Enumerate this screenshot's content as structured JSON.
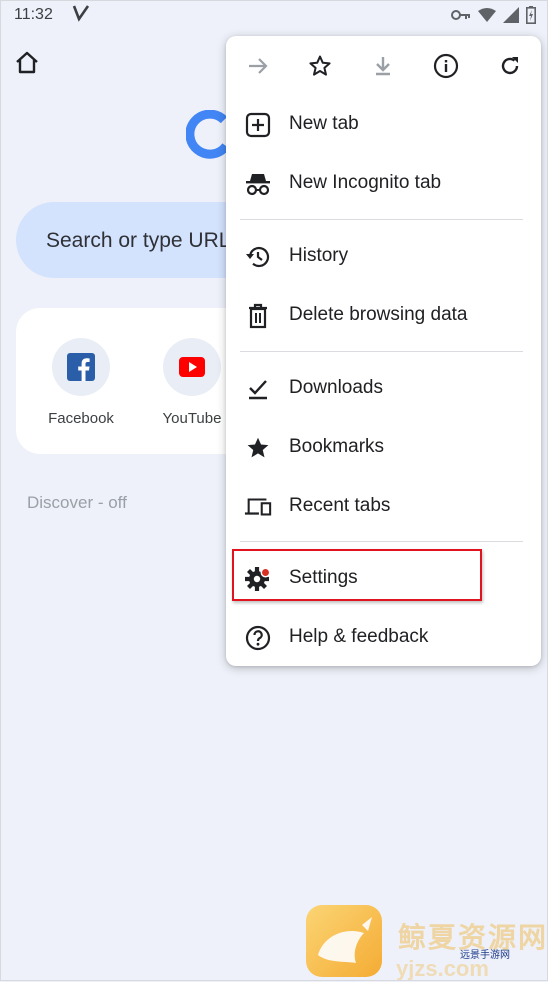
{
  "status_bar": {
    "time": "11:32",
    "icons": [
      "vpn-key-icon",
      "wifi-icon",
      "signal-icon",
      "battery-icon"
    ]
  },
  "page": {
    "omnibox_placeholder": "Search or type URL",
    "tiles": [
      {
        "label": "Facebook",
        "icon": "facebook-icon"
      },
      {
        "label": "YouTube",
        "icon": "youtube-icon"
      }
    ],
    "discover_label": "Discover - off"
  },
  "menu": {
    "toolbar": [
      "forward-icon",
      "star-icon",
      "download-icon",
      "info-icon",
      "refresh-icon"
    ],
    "items": [
      {
        "label": "New tab",
        "icon": "plus-box-icon"
      },
      {
        "label": "New Incognito tab",
        "icon": "incognito-icon"
      },
      {
        "label": "History",
        "icon": "history-icon"
      },
      {
        "label": "Delete browsing data",
        "icon": "trash-icon"
      },
      {
        "label": "Downloads",
        "icon": "downloads-check-icon"
      },
      {
        "label": "Bookmarks",
        "icon": "star-filled-icon"
      },
      {
        "label": "Recent tabs",
        "icon": "devices-icon"
      },
      {
        "label": "Settings",
        "icon": "gear-icon"
      },
      {
        "label": "Help & feedback",
        "icon": "help-icon"
      }
    ],
    "highlighted_item": "Settings",
    "highlight_color": "#e0131f"
  },
  "watermark": {
    "title": "鲸夏资源网",
    "subtitle": "远景手游网",
    "url": "yjzs.com"
  },
  "colors": {
    "background": "#eef1f9",
    "omnibox": "#d3e3fd",
    "youtube_red": "#ff0000",
    "facebook_blue": "#1877f2",
    "settings_dot": "#d93025"
  }
}
